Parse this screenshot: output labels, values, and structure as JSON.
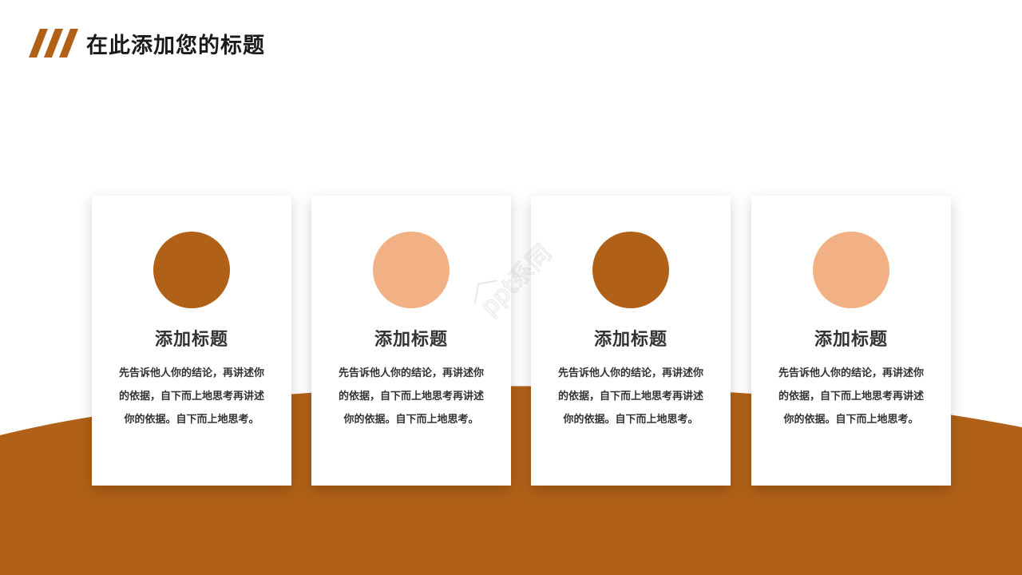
{
  "header": {
    "title": "在此添加您的标题"
  },
  "colors": {
    "brand_brown": "#b06117",
    "peach": "#f2b185",
    "text_dark": "#333333"
  },
  "cards": [
    {
      "title": "添加标题",
      "body": "先告诉他人你的结论，再讲述你的依据，自下而上地思考再讲述你的依据。自下而上地思考。",
      "circle_color": "#b06117"
    },
    {
      "title": "添加标题",
      "body": "先告诉他人你的结论，再讲述你的依据，自下而上地思考再讲述你的依据。自下而上地思考。",
      "circle_color": "#f2b185"
    },
    {
      "title": "添加标题",
      "body": "先告诉他人你的结论，再讲述你的依据，自下而上地思考再讲述你的依据。自下而上地思考。",
      "circle_color": "#b06117"
    },
    {
      "title": "添加标题",
      "body": "先告诉他人你的结论，再讲述你的依据，自下而上地思考再讲述你的依据。自下而上地思考。",
      "circle_color": "#f2b185"
    }
  ],
  "watermark": {
    "text": "ppt系同"
  }
}
